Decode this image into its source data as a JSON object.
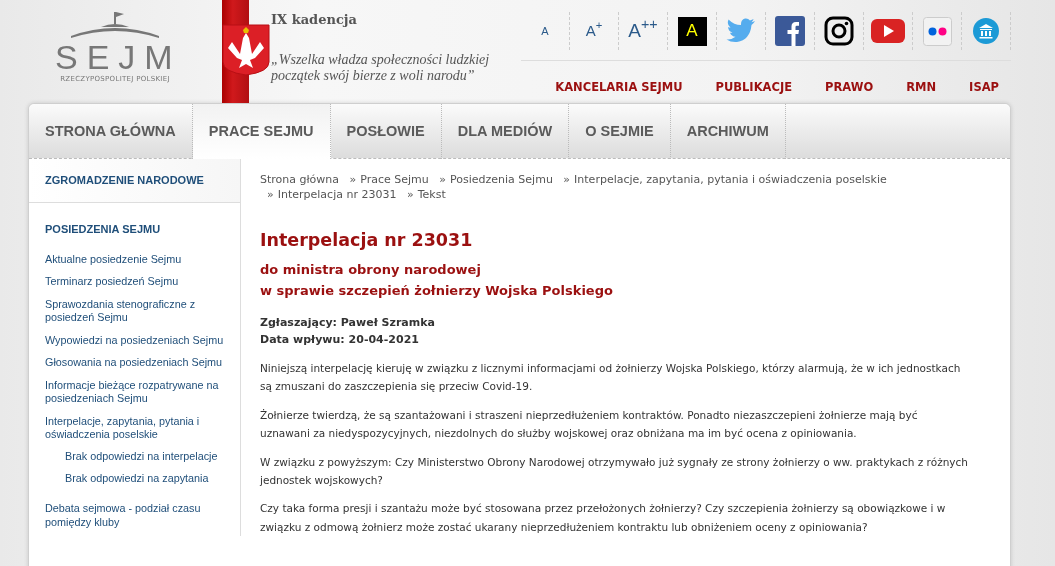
{
  "header": {
    "logo": {
      "title": "SEJM",
      "subtitle": "RZECZYPOSPOLITEJ POLSKIEJ"
    },
    "term": "IX kadencja",
    "motto": "„Wszelka władza społeczności ludzkiej początek swój bierze z woli narodu”",
    "font_size_buttons": [
      "A",
      "A$^{+}$",
      "A$^{++}$"
    ],
    "contrast_button": "A",
    "social": [
      {
        "kind": "twitter"
      },
      {
        "kind": "facebook"
      },
      {
        "kind": "instagram"
      },
      {
        "kind": "youtube"
      },
      {
        "kind": "flickr"
      },
      {
        "kind": "museum"
      }
    ],
    "top_links": [
      "KANCELARIA SEJMU",
      "PUBLIKACJE",
      "PRAWO",
      "RMN",
      "ISAP"
    ]
  },
  "nav": {
    "tabs": [
      {
        "label": "STRONA GŁÓWNA",
        "selected": false
      },
      {
        "label": "PRACE SEJMU",
        "selected": true
      },
      {
        "label": "POSŁOWIE",
        "selected": false
      },
      {
        "label": "DLA MEDIÓW",
        "selected": false
      },
      {
        "label": "O SEJMIE",
        "selected": false
      },
      {
        "label": "ARCHIWUM",
        "selected": false
      }
    ]
  },
  "sidebar": {
    "sections": [
      {
        "title": "ZGROMADZENIE NARODOWE"
      },
      {
        "title": "POSIEDZENIA SEJMU",
        "items": [
          {
            "label": "Aktualne posiedzenie Sejmu"
          },
          {
            "label": "Terminarz posiedzeń Sejmu"
          },
          {
            "label": "Sprawozdania stenograficzne z posiedzeń Sejmu"
          },
          {
            "label": "Wypowiedzi na posiedzeniach Sejmu"
          },
          {
            "label": "Głosowania na posiedzeniach Sejmu"
          },
          {
            "label": "Informacje bieżące rozpatrywane na posiedzeniach Sejmu"
          },
          {
            "label": "Interpelacje, zapytania, pytania i oświadczenia poselskie",
            "children": [
              {
                "label": "Brak odpowiedzi na interpelacje"
              },
              {
                "label": "Brak odpowiedzi na zapytania"
              }
            ]
          },
          {
            "label": "Debata sejmowa - podział czasu pomiędzy kluby"
          }
        ]
      }
    ]
  },
  "breadcrumb": [
    {
      "label": "Strona główna"
    },
    {
      "separator": "»",
      "label": "Prace Sejmu"
    },
    {
      "separator": "»",
      "label": "Posiedzenia Sejmu"
    },
    {
      "separator": "»",
      "label": "Interpelacje, zapytania, pytania i oświadczenia poselskie"
    },
    {
      "separator": "»",
      "label": "Interpelacja nr 23031"
    },
    {
      "separator": "»",
      "label": "Tekst"
    }
  ],
  "article": {
    "title": "Interpelacja nr 23031",
    "subtitle": [
      "do ministra obrony narodowej",
      "w sprawie szczepień żołnierzy Wojska Polskiego"
    ],
    "meta": [
      "Zgłaszający: Paweł Szramka",
      "Data wpływu: 20-04-2021"
    ],
    "paragraphs": [
      "Niniejszą interpelację kieruję w związku z licznymi informacjami od żołnierzy Wojska Polskiego, którzy alarmują, że w ich jednostkach są zmuszani do zaszczepienia się przeciw Covid-19.",
      "Żołnierze twierdzą, że są szantażowani i straszeni nieprzedłużeniem kontraktów. Ponadto niezaszczepieni żołnierze mają być uznawani za niedyspozycyjnych, niezdolnych do służby wojskowej oraz obniżana ma im być ocena z opiniowania.",
      "W związku z powyższym: Czy Ministerstwo Obrony Narodowej otrzymywało już sygnały ze strony żołnierzy o ww. praktykach z różnych jednostek wojskowych?",
      "Czy taka forma presji i szantażu może być stosowana przez przełożonych żołnierzy? Czy szczepienia żołnierzy są obowiązkowe i w związku z odmową żołnierz może zostać ukarany nieprzedłużeniem kontraktu lub obniżeniem oceny z opiniowania?"
    ]
  }
}
